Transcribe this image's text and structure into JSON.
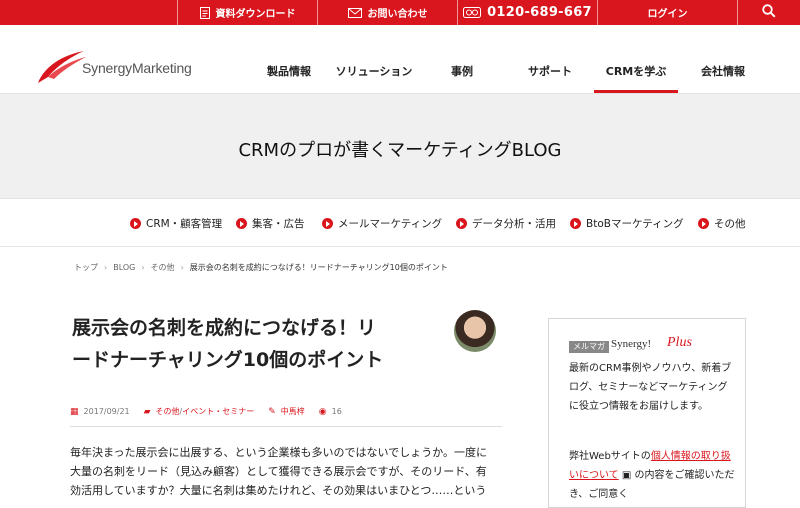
{
  "topbar": {
    "download_label": "資料ダウンロード",
    "contact_label": "お問い合わせ",
    "phone_label": "0120-689-667",
    "login_label": "ログイン",
    "icons": [
      "document-icon",
      "mail-icon",
      "phone-icon",
      "search-icon"
    ]
  },
  "brand": {
    "logo_text": "SynergyMarketing",
    "accent_color": "#d9161d"
  },
  "nav": {
    "items": [
      "製品情報",
      "ソリューション",
      "事例",
      "サポート",
      "CRMを学ぶ",
      "会社情報"
    ],
    "active": "CRMを学ぶ"
  },
  "hero": {
    "title": "CRMのプロが書くマーケティングBLOG"
  },
  "categories": [
    "CRM・顧客管理",
    "集客・広告",
    "メールマーケティング",
    "データ分析・活用",
    "BtoBマーケティング",
    "その他"
  ],
  "breadcrumb": [
    "トップ",
    "BLOG",
    "その他",
    "展示会の名刺を成約につなげる！リードナーチャリング10個のポイント"
  ],
  "article": {
    "title_line1": "展示会の名刺を成約につなげる！リ",
    "title_line2": "ードナーチャリング10個のポイント",
    "date": "2017/09/21",
    "category_1": "その他",
    "category_2": "イベント・セミナー",
    "category_sep": " / ",
    "author": "中馬梓",
    "views": "16",
    "body_line1": "毎年決まった展示会に出展する、という企業様も多いのではないでしょうか。一度に",
    "body_line2": "大量の名刺をリード（見込み顧客）として獲得できる展示会ですが、そのリード、有",
    "body_line3": "効活用していますか？大量に名刺は集めたけれど、その効果はいまひとつ……という"
  },
  "sidebar": {
    "tag": "メルマガ",
    "brand": "Synergy!",
    "brand_plus": "Plus",
    "text1": "最新のCRM事例やノウハウ、新着ブログ、セミナーなどマーケティングに役立つ情報をお届けします。",
    "text2_pre": "弊社Webサイトの",
    "text2_link": "個人情報の取り扱いについて",
    "text2_post": "の内容をご確認いただき、ご同意く"
  }
}
